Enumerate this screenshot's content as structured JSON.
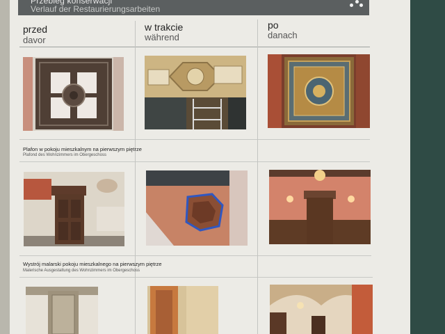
{
  "header": {
    "title_pl": "Przebieg konserwacji",
    "title_de": "Verlauf der Restaurierungsarbeiten",
    "logo_icon": "dots-logo-icon"
  },
  "columns": [
    {
      "pl": "przed",
      "de": "davor"
    },
    {
      "pl": "w trakcie",
      "de": "während"
    },
    {
      "pl": "po",
      "de": "danach"
    }
  ],
  "sections": [
    {
      "caption_pl": "Plafon w pokoju mieszkalnym na pierwszym piętrze",
      "caption_de": "Plafond des Wohnzimmers im Obergeschoss"
    },
    {
      "caption_pl": "Wystrój malarski pokoju mieszkalnego na pierwszym piętrze",
      "caption_de": "Malerische Ausgestaltung des Wohnzimmers im Obergeschoss"
    }
  ],
  "photos": {
    "r1": [
      "ceiling-before-photo",
      "ceiling-scaffolding-photo",
      "ceiling-after-photo"
    ],
    "r2": [
      "wall-door-before-photo",
      "wall-masking-photo",
      "room-after-photo"
    ],
    "r3": [
      "fabric-panel-photo",
      "painted-panel-photo",
      "vaulted-hall-photo"
    ]
  }
}
